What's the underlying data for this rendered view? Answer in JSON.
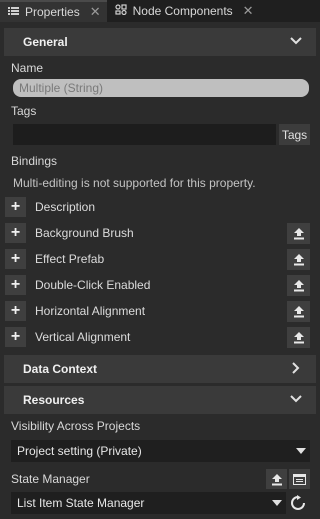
{
  "tabs": [
    {
      "label": "Properties",
      "icon": "list-icon",
      "active": true
    },
    {
      "label": "Node Components",
      "icon": "components-icon",
      "active": false
    }
  ],
  "sections": {
    "general": "General",
    "data_context": "Data Context",
    "resources": "Resources"
  },
  "fields": {
    "name_label": "Name",
    "name_value": "Multiple (String)",
    "tags_label": "Tags",
    "tags_button": "Tags",
    "bindings_label": "Bindings",
    "bindings_note": "Multi-editing is not supported for this property.",
    "visibility_label": "Visibility Across Projects",
    "visibility_value": "Project setting (Private)",
    "state_manager_label": "State Manager",
    "state_manager_value": "List Item State Manager"
  },
  "bindings": [
    {
      "label": "Description",
      "has_up": false
    },
    {
      "label": "Background Brush",
      "has_up": true
    },
    {
      "label": "Effect Prefab",
      "has_up": true
    },
    {
      "label": "Double-Click Enabled",
      "has_up": true
    },
    {
      "label": "Horizontal Alignment",
      "has_up": true
    },
    {
      "label": "Vertical Alignment",
      "has_up": true
    }
  ],
  "colors": {
    "background": "#2b2b2b",
    "header": "#3a3a3a",
    "input": "#1f1f1f",
    "text": "#dcdcdc"
  }
}
